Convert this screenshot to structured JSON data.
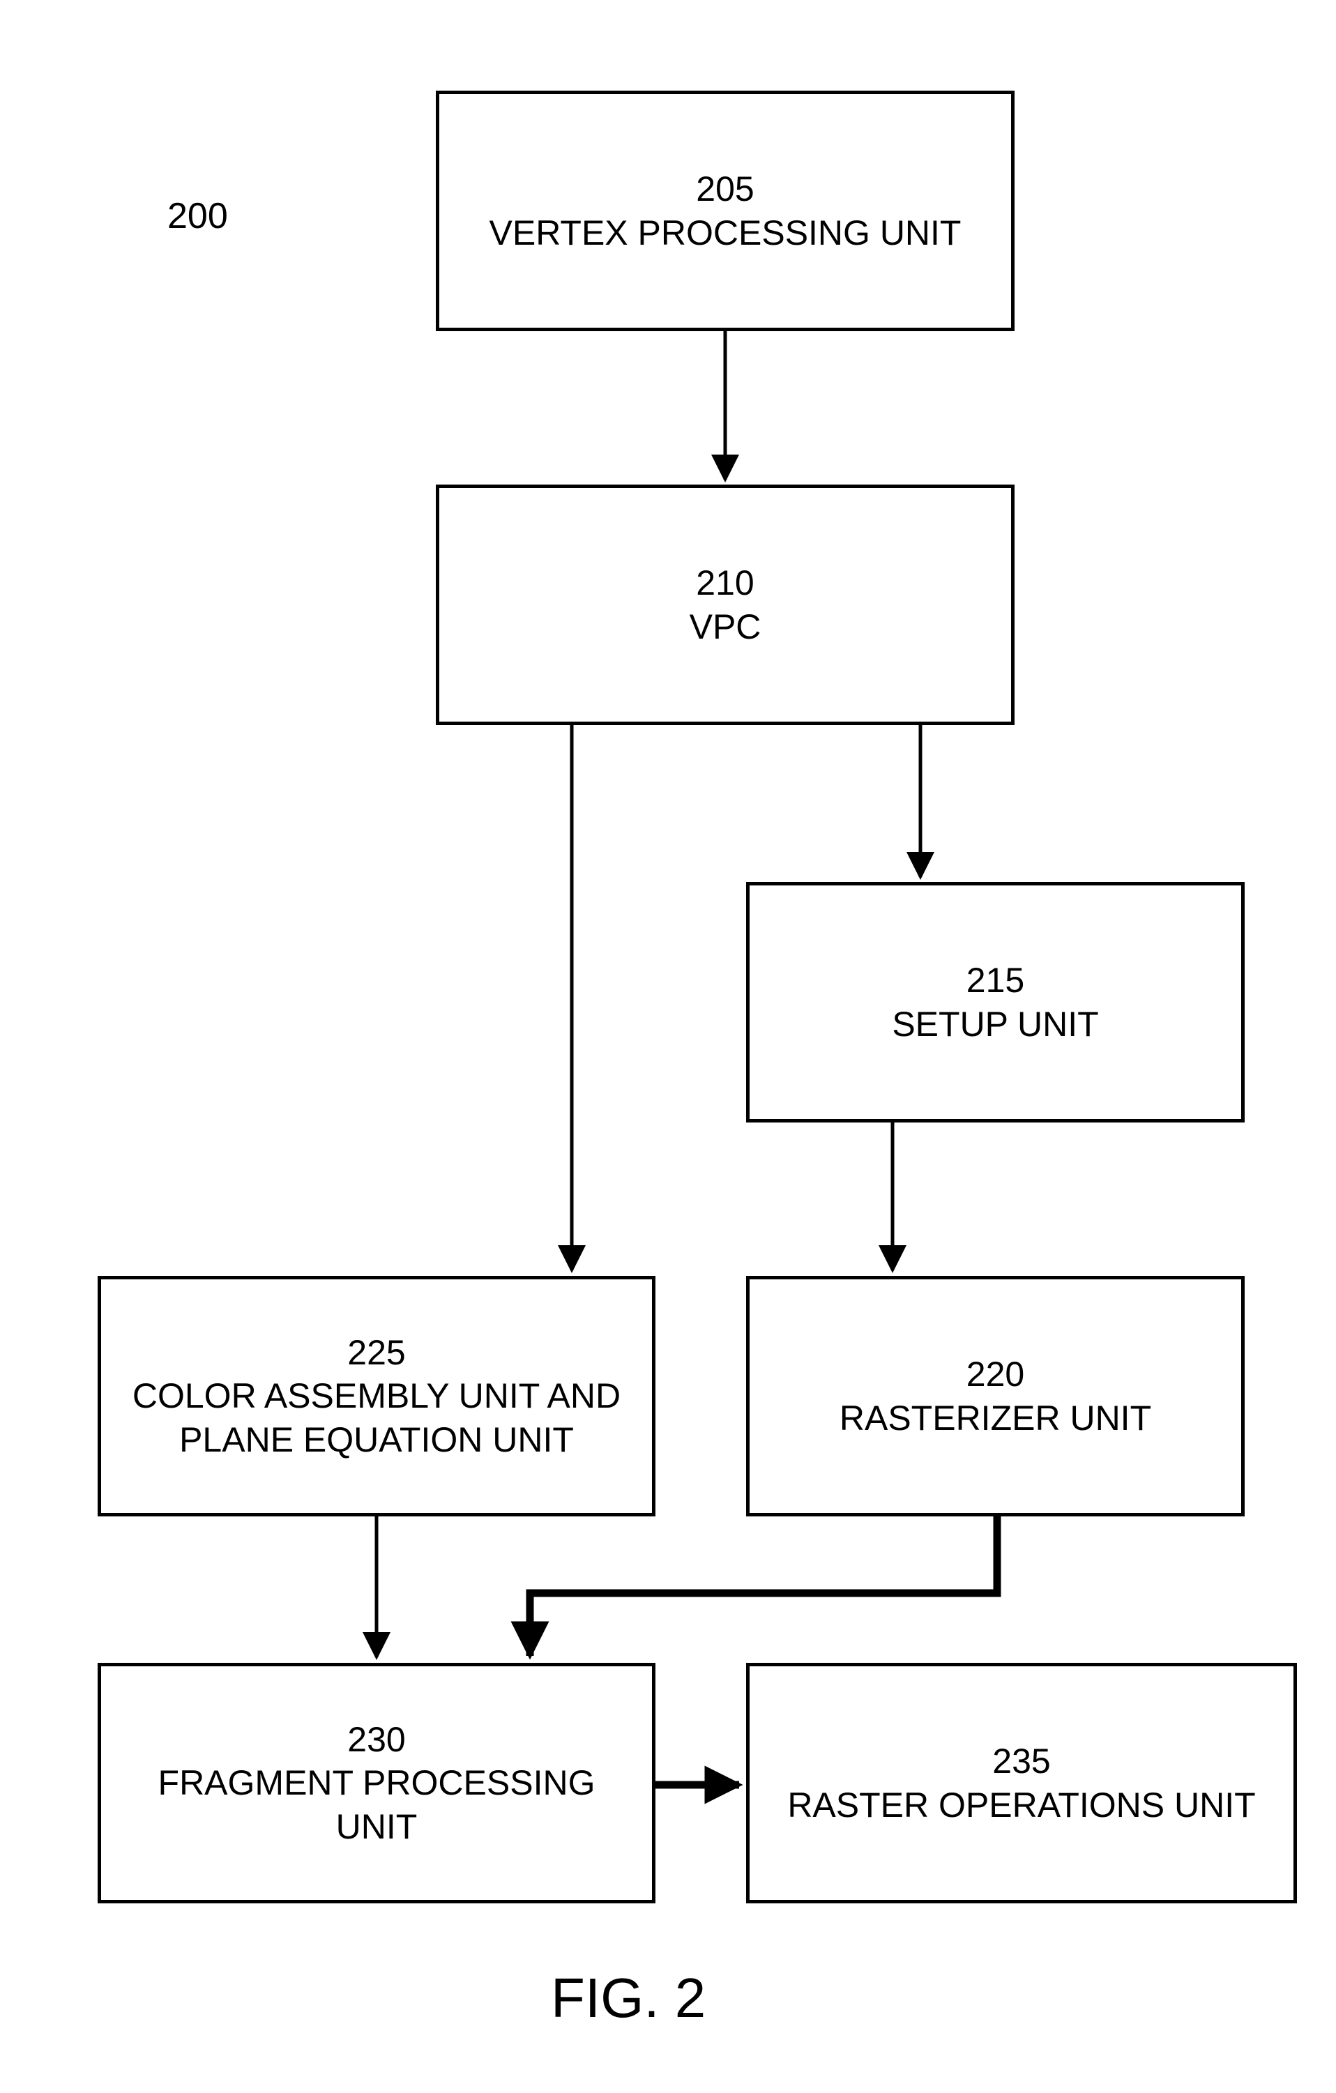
{
  "diagram_label": "200",
  "figure_caption": "FIG. 2",
  "boxes": {
    "vpu": {
      "num": "205",
      "label": "VERTEX PROCESSING UNIT"
    },
    "vpc": {
      "num": "210",
      "label": "VPC"
    },
    "setup": {
      "num": "215",
      "label": "SETUP UNIT"
    },
    "rast": {
      "num": "220",
      "label": "RASTERIZER UNIT"
    },
    "color": {
      "num": "225",
      "label": "COLOR ASSEMBLY UNIT AND PLANE EQUATION UNIT"
    },
    "frag": {
      "num": "230",
      "label": "FRAGMENT PROCESSING UNIT"
    },
    "rop": {
      "num": "235",
      "label": "RASTER OPERATIONS UNIT"
    }
  }
}
